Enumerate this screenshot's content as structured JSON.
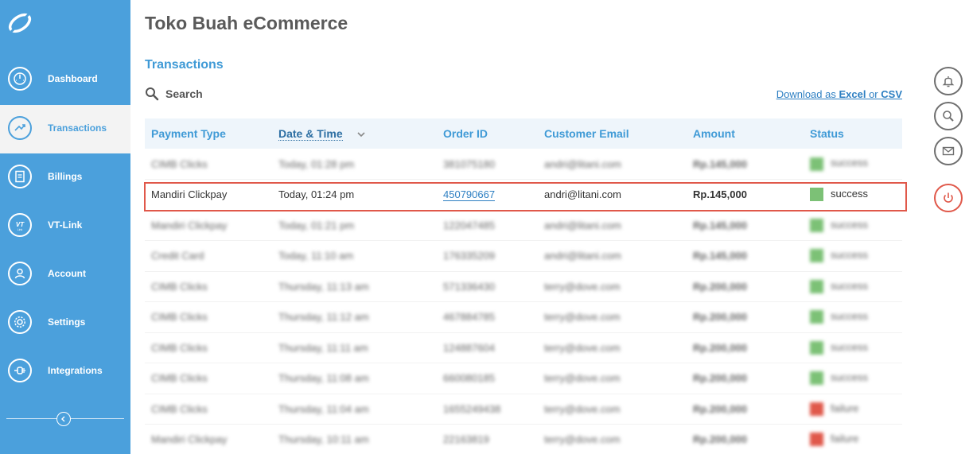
{
  "app_title": "Toko Buah eCommerce",
  "section_title": "Transactions",
  "search_label": "Search",
  "download": {
    "prefix": "Download as ",
    "excel": "Excel",
    "or": " or ",
    "csv": "CSV"
  },
  "sidebar": {
    "items": [
      {
        "label": "Dashboard",
        "icon": "dashboard-icon"
      },
      {
        "label": "Transactions",
        "icon": "transactions-icon",
        "active": true
      },
      {
        "label": "Billings",
        "icon": "billings-icon"
      },
      {
        "label": "VT-Link",
        "icon": "vt-link-icon"
      },
      {
        "label": "Account",
        "icon": "account-icon"
      },
      {
        "label": "Settings",
        "icon": "settings-icon"
      },
      {
        "label": "Integrations",
        "icon": "integrations-icon"
      }
    ]
  },
  "table": {
    "headers": [
      "Payment Type",
      "Date & Time",
      "Order ID",
      "Customer Email",
      "Amount",
      "Status"
    ],
    "rows": [
      {
        "payment": "CIMB Clicks",
        "datetime": "Today, 01:28 pm",
        "order": "381075180",
        "email": "andri@litani.com",
        "amount": "Rp.145,000",
        "status": "success"
      },
      {
        "payment": "Mandiri Clickpay",
        "datetime": "Today, 01:24 pm",
        "order": "450790667",
        "email": "andri@litani.com",
        "amount": "Rp.145,000",
        "status": "success"
      },
      {
        "payment": "Mandiri Clickpay",
        "datetime": "Today, 01:21 pm",
        "order": "122047485",
        "email": "andri@litani.com",
        "amount": "Rp.145,000",
        "status": "success"
      },
      {
        "payment": "Credit Card",
        "datetime": "Today, 11:10 am",
        "order": "176335209",
        "email": "andri@litani.com",
        "amount": "Rp.145,000",
        "status": "success"
      },
      {
        "payment": "CIMB Clicks",
        "datetime": "Thursday, 11:13 am",
        "order": "571336430",
        "email": "terry@dove.com",
        "amount": "Rp.200,000",
        "status": "success"
      },
      {
        "payment": "CIMB Clicks",
        "datetime": "Thursday, 11:12 am",
        "order": "467884785",
        "email": "terry@dove.com",
        "amount": "Rp.200,000",
        "status": "success"
      },
      {
        "payment": "CIMB Clicks",
        "datetime": "Thursday, 11:11 am",
        "order": "124887604",
        "email": "terry@dove.com",
        "amount": "Rp.200,000",
        "status": "success"
      },
      {
        "payment": "CIMB Clicks",
        "datetime": "Thursday, 11:08 am",
        "order": "660080185",
        "email": "terry@dove.com",
        "amount": "Rp.200,000",
        "status": "success"
      },
      {
        "payment": "CIMB Clicks",
        "datetime": "Thursday, 11:04 am",
        "order": "1655249438",
        "email": "terry@dove.com",
        "amount": "Rp.200,000",
        "status": "failure"
      },
      {
        "payment": "Mandiri Clickpay",
        "datetime": "Thursday, 10:11 am",
        "order": "22163819",
        "email": "terry@dove.com",
        "amount": "Rp.200,000",
        "status": "failure"
      }
    ],
    "focus_row_index": 1
  },
  "colors": {
    "accent": "#4ba0dc",
    "success": "#7cc176",
    "failure": "#e0584a",
    "highlight": "#e0584a"
  },
  "rail": [
    "bell-icon",
    "search-icon",
    "mail-icon",
    "power-icon"
  ]
}
